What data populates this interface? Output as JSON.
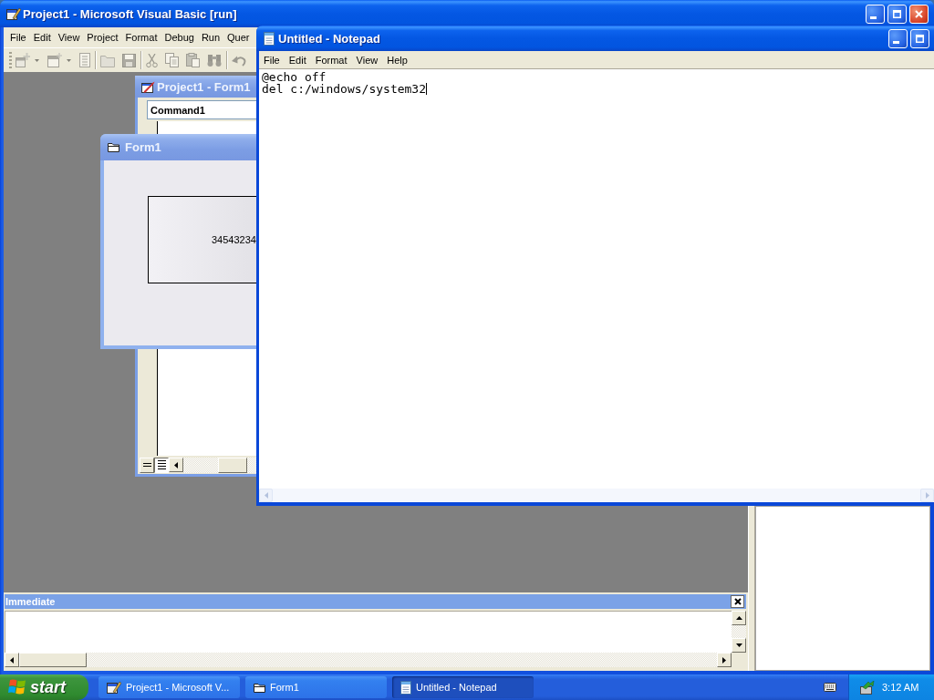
{
  "vb_window": {
    "title": "Project1 - Microsoft Visual Basic [run]",
    "menu": [
      "File",
      "Edit",
      "View",
      "Project",
      "Format",
      "Debug",
      "Run",
      "Quer"
    ],
    "toolbar": [
      {
        "kind": "add-project",
        "disabled": true
      },
      {
        "kind": "dropdown",
        "disabled": true
      },
      {
        "kind": "add-form",
        "disabled": true
      },
      {
        "kind": "dropdown",
        "disabled": true
      },
      {
        "kind": "menu-editor",
        "disabled": true
      },
      {
        "kind": "separator"
      },
      {
        "kind": "open",
        "disabled": true
      },
      {
        "kind": "save",
        "disabled": true
      },
      {
        "kind": "separator"
      },
      {
        "kind": "cut",
        "disabled": true
      },
      {
        "kind": "copy",
        "disabled": true
      },
      {
        "kind": "paste",
        "disabled": true
      },
      {
        "kind": "find",
        "disabled": true
      },
      {
        "kind": "separator"
      },
      {
        "kind": "undo",
        "disabled": true
      }
    ]
  },
  "code_window": {
    "title": "Project1 - Form1",
    "object_box": "Command1",
    "view_buttons": [
      {
        "kind": "procedure-view",
        "selected": false
      },
      {
        "kind": "module-view",
        "selected": true
      }
    ]
  },
  "form_window": {
    "title": "Form1",
    "command_button": "34543234"
  },
  "immediate_window": {
    "title": "Immediate"
  },
  "notepad": {
    "title": "Untitled - Notepad",
    "menu": [
      "File",
      "Edit",
      "Format",
      "View",
      "Help"
    ],
    "lines": [
      "@echo off",
      "del c:/windows/system32"
    ]
  },
  "taskbar": {
    "start": "start",
    "tasks": [
      {
        "kind": "vb",
        "label": "Project1 - Microsoft V...",
        "selected": false
      },
      {
        "kind": "form",
        "label": "Form1",
        "selected": false
      },
      {
        "kind": "notepad",
        "label": "Untitled - Notepad",
        "selected": true
      }
    ],
    "clock": "3:12 AM"
  }
}
